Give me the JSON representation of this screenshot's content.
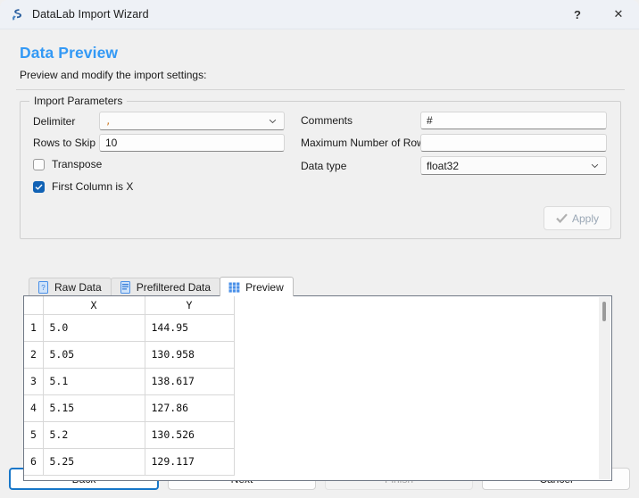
{
  "window": {
    "title": "DataLab Import Wizard",
    "icon": "datalab-logo-icon",
    "help_label": "?",
    "close_label": "✕"
  },
  "page": {
    "title": "Data Preview",
    "title_color": "#3399f5",
    "subtitle": "Preview and modify the import settings:"
  },
  "import_parameters": {
    "group_title": "Import Parameters",
    "delimiter": {
      "label": "Delimiter",
      "value": ",",
      "type": "combobox"
    },
    "rows_to_skip": {
      "label": "Rows to Skip",
      "value": "10",
      "type": "text"
    },
    "transpose": {
      "label": "Transpose",
      "checked": false
    },
    "first_column_is_x": {
      "label": "First Column is X",
      "checked": true
    },
    "comments": {
      "label": "Comments",
      "value": "#",
      "type": "text"
    },
    "maximum_number_of_rows": {
      "label": "Maximum Number of Rows",
      "value": "",
      "type": "text"
    },
    "data_type": {
      "label": "Data type",
      "value": "float32",
      "type": "combobox"
    },
    "apply_button": {
      "label": "Apply",
      "icon": "check-icon",
      "enabled": false
    }
  },
  "tabs": [
    {
      "label": "Raw Data",
      "icon": "raw-data-icon",
      "active": false
    },
    {
      "label": "Prefiltered Data",
      "icon": "prefiltered-data-icon",
      "active": false
    },
    {
      "label": "Preview",
      "icon": "preview-grid-icon",
      "active": true
    }
  ],
  "table": {
    "columns": [
      "X",
      "Y"
    ],
    "rows": [
      {
        "n": "1",
        "x": "5.0",
        "y": "144.95"
      },
      {
        "n": "2",
        "x": "5.05",
        "y": "130.958"
      },
      {
        "n": "3",
        "x": "5.1",
        "y": "138.617"
      },
      {
        "n": "4",
        "x": "5.15",
        "y": "127.86"
      },
      {
        "n": "5",
        "x": "5.2",
        "y": "130.526"
      },
      {
        "n": "6",
        "x": "5.25",
        "y": "129.117"
      }
    ]
  },
  "footer": {
    "back": {
      "label": "Back",
      "default": true,
      "enabled": true
    },
    "next": {
      "label": "Next",
      "enabled": true
    },
    "finish": {
      "label": "Finish",
      "enabled": false
    },
    "cancel": {
      "label": "Cancel",
      "enabled": true
    }
  },
  "colors": {
    "accent": "#3399f5",
    "checkbox_checked": "#1162b5",
    "default_button_border": "#1877c9",
    "tab_icon_blue": "#4a90e8"
  }
}
